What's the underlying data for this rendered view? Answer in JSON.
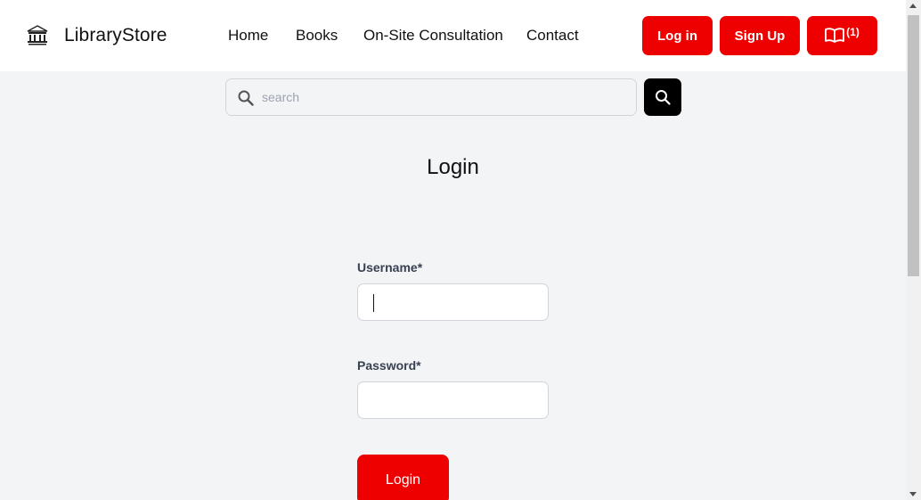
{
  "header": {
    "brand": "LibraryStore",
    "logo_icon": "library-building-icon",
    "nav": [
      {
        "label": "Home"
      },
      {
        "label": "Books"
      },
      {
        "label": "On-Site Consultation"
      },
      {
        "label": "Contact"
      }
    ],
    "login_label": "Log in",
    "signup_label": "Sign Up",
    "cart_icon": "open-book-icon",
    "cart_count": "(1)"
  },
  "search": {
    "placeholder": "search",
    "value": "",
    "icon": "search-icon"
  },
  "main": {
    "title": "Login",
    "username_label": "Username*",
    "username_value": "",
    "password_label": "Password*",
    "password_value": "",
    "submit_label": "Login"
  },
  "colors": {
    "accent": "#ee0000",
    "background": "#f3f4f6",
    "search_button": "#000000"
  }
}
